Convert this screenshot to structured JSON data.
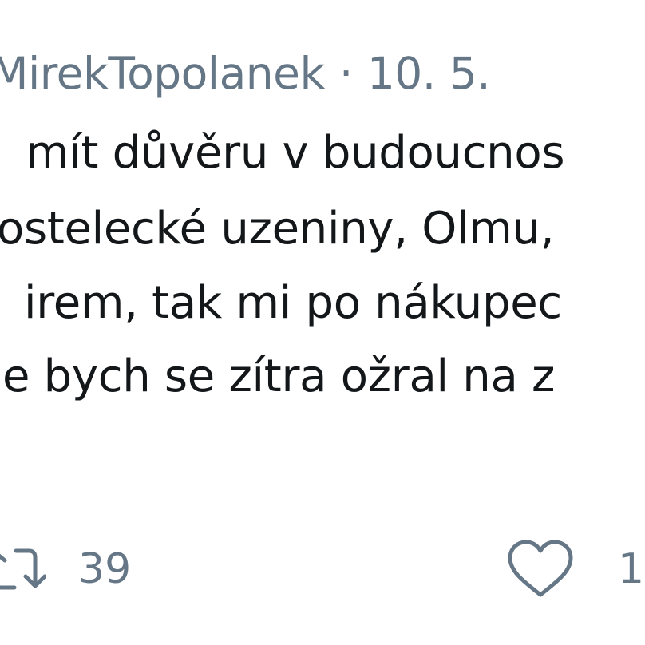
{
  "tweet": {
    "author": "MirekTopolanek",
    "separator": "·",
    "date": "10. 5.",
    "lines": [
      "mít důvěru v budoucnos",
      "ostelecké uzeniny, Olmu,",
      "irem, tak mi po nákupec",
      "e bych se zítra ožral na z"
    ]
  },
  "actions": {
    "retweet": {
      "icon": "retweet-icon",
      "count": "39"
    },
    "like": {
      "icon": "heart-icon",
      "count": "1"
    }
  },
  "colors": {
    "text": "#14171a",
    "muted": "#657786"
  }
}
